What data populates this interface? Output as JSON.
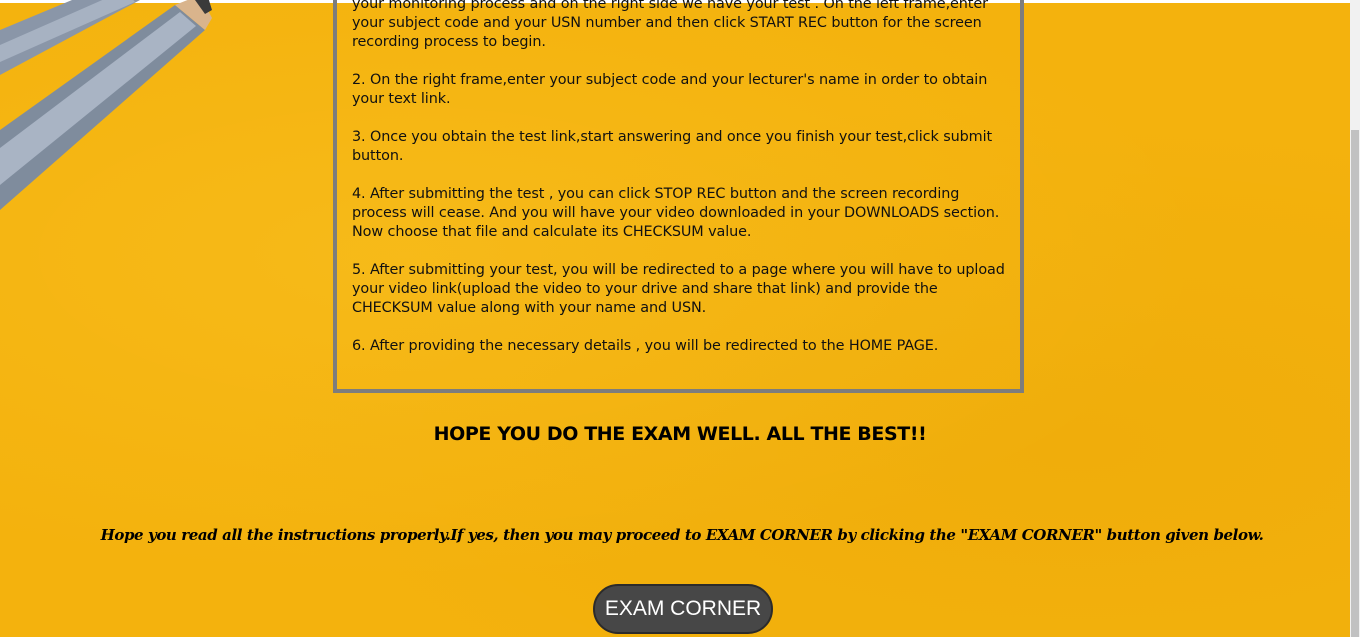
{
  "instructions": {
    "p1": "your monitoring process and on the right side we have your test . On the left frame,enter your subject code and your USN number and then click START REC button for the screen recording process to begin.",
    "p2": "2. On the right frame,enter your subject code and your lecturer's name in order to obtain your text link.",
    "p3": "3. Once you obtain the test link,start answering and once you finish your test,click submit button.",
    "p4": "4. After submitting the test , you can click STOP REC button and the screen recording process will cease. And you will have your video downloaded in your DOWNLOADS section. Now choose that file and calculate its CHECKSUM value.",
    "p5": "5. After submitting your test, you will be redirected to a page where you will have to upload your video link(upload the video to your drive and share that link) and provide the CHECKSUM value along with your name and USN.",
    "p6": "6. After providing the necessary details , you will be redirected to the HOME PAGE."
  },
  "wish": "HOPE YOU DO THE EXAM WELL. ALL THE BEST!!",
  "proceed_note": "Hope you read all the instructions properly.If yes, then you may proceed to EXAM CORNER by clicking the \"EXAM CORNER\" button given below.",
  "exam_button_label": "EXAM CORNER",
  "colors": {
    "background": "#f4b20d",
    "box_border": "#7d7d7d",
    "button_bg": "#474747",
    "button_text": "#ffffff"
  }
}
